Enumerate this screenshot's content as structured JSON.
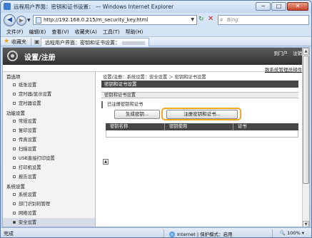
{
  "window": {
    "title": "远程用户界面：密钥和证书设置：                — Windows Internet Explorer",
    "min": "─",
    "max": "□",
    "close": "✕"
  },
  "address": {
    "url": "http://192.168.0.215/m_security_key.html",
    "search_placeholder": "Bing"
  },
  "menu": [
    "文件(F)",
    "编辑(E)",
    "查看(V)",
    "收藏夹(A)",
    "工具(T)",
    "帮助(H)"
  ],
  "favbar": {
    "favorites_label": "收藏夹",
    "tab_label": "远程用户界面：密钥和证书设置："
  },
  "header": {
    "title": "设置/注册",
    "top_links": [
      "到门户",
      "注销"
    ],
    "mail_link": "致系统管理员邮件"
  },
  "sidebar": {
    "sections": [
      {
        "title": "首选项",
        "items": [
          "纸张设置",
          "定时器/显示设置",
          "定时器设置"
        ]
      },
      {
        "title": "功能设置",
        "items": [
          "常规设置",
          "复印设置",
          "传真设置",
          "扫描设置",
          "USB直接打印设置",
          "打印机设置",
          "报告设置"
        ]
      },
      {
        "title": "系统设置",
        "items": [
          "系统设置",
          "部门识别码管理",
          "网络设置",
          "安全设置"
        ]
      }
    ]
  },
  "main": {
    "breadcrumb": "设置/注册：系统设置：安全设置 ＞ 密钥和证书设置",
    "page_title": "密钥和证书设置",
    "section_title": "密钥和证书设置",
    "registered_heading": "已注册密钥和证书",
    "btn_generate": "生成密钥...",
    "btn_register": "注册密钥和证书...",
    "columns": [
      "密钥名称",
      "密钥使用",
      "证书"
    ],
    "scroll_top_label": "▲"
  },
  "status": {
    "done": "完成",
    "zone": "Internet | 保护模式：启用",
    "zoom": "100%"
  },
  "colors": {
    "highlight": "#f5a623",
    "header_bg": "#3a3a3a"
  }
}
